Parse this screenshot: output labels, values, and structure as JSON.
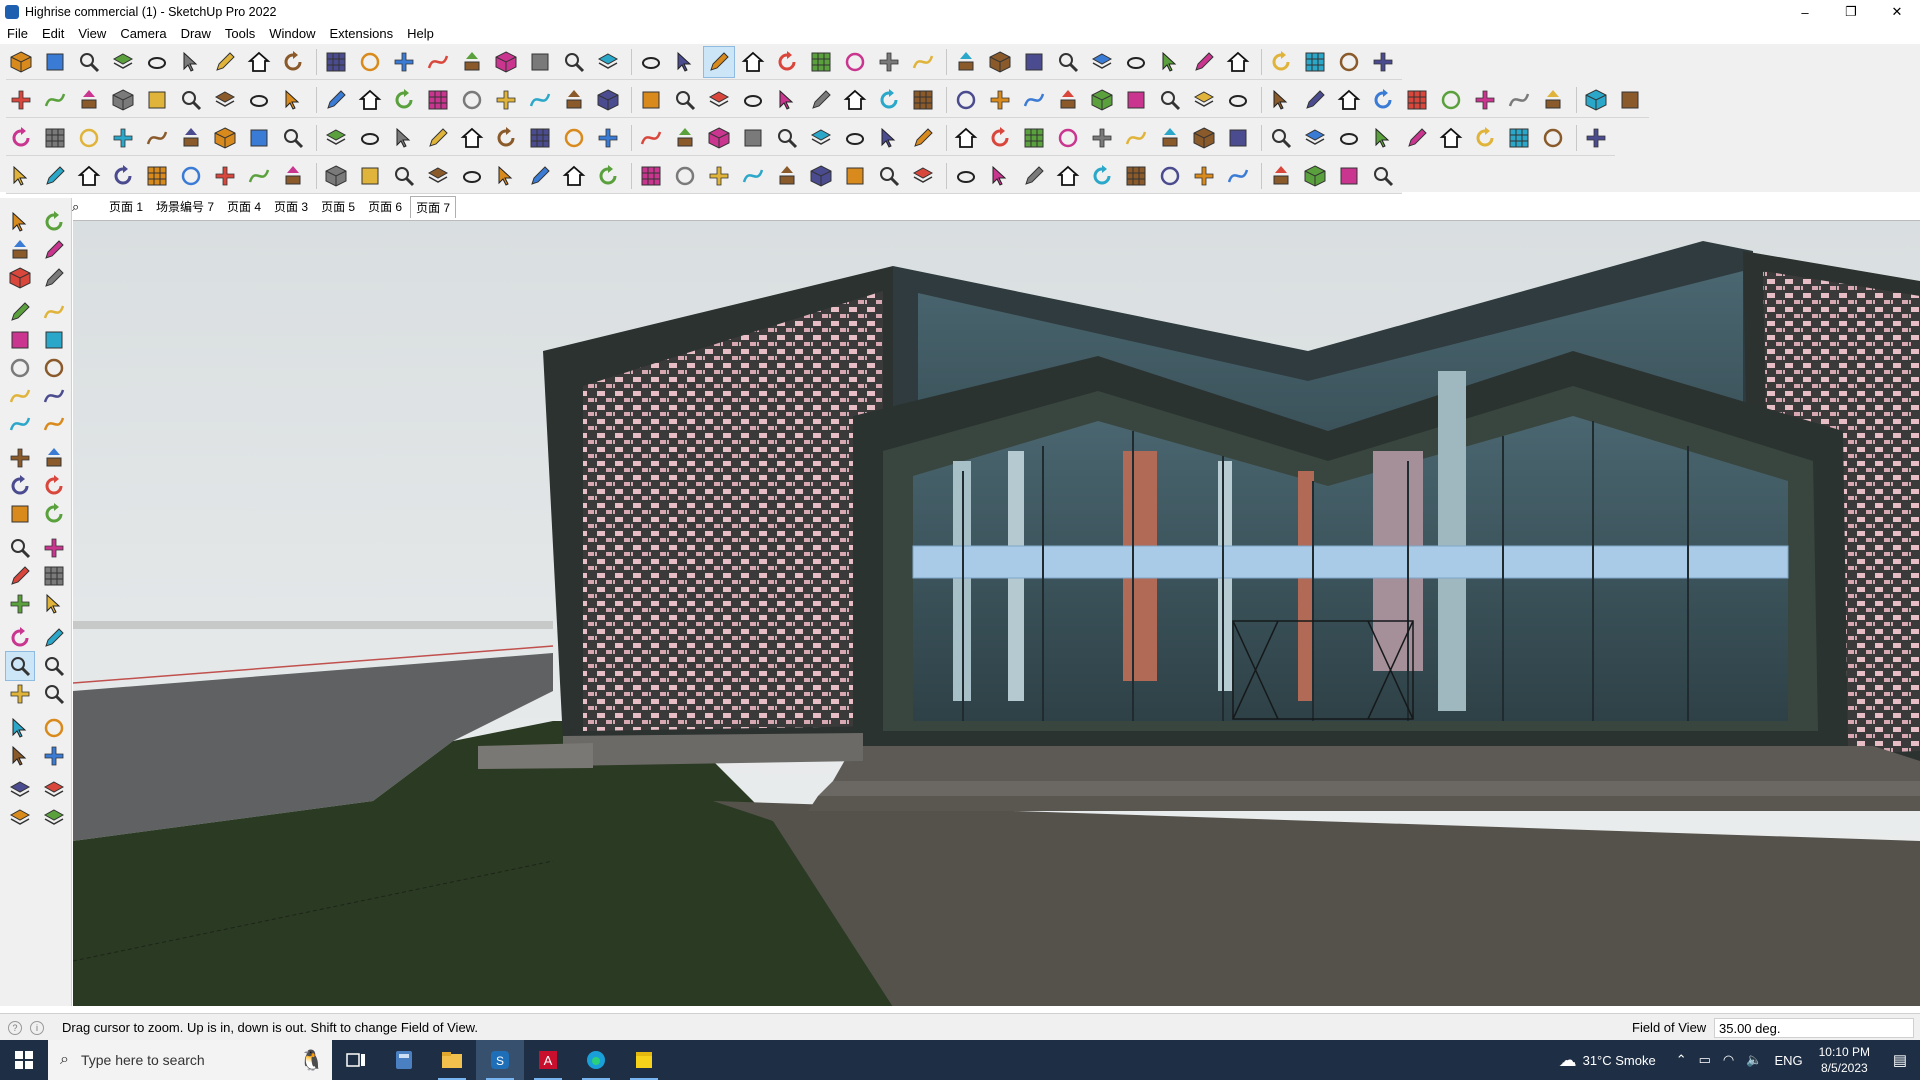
{
  "window": {
    "title": "Highrise commercial (1) - SketchUp Pro 2022",
    "minimize": "–",
    "maximize": "❐",
    "close": "✕"
  },
  "menubar": [
    "File",
    "Edit",
    "View",
    "Camera",
    "Draw",
    "Tools",
    "Window",
    "Extensions",
    "Help"
  ],
  "scenes": {
    "tabs": [
      "页面 1",
      "场景编号 7",
      "页面 4",
      "页面 3",
      "页面 5",
      "页面 6",
      "页面 7"
    ],
    "active_index": 6
  },
  "status": {
    "hint": "Drag cursor to zoom.  Up is in, down is out. Shift to change Field of View.",
    "vcb_label": "Field of View",
    "vcb_value": "35.00 deg."
  },
  "taskbar": {
    "search_placeholder": "Type here to search",
    "apps": [
      {
        "icon": "task-view-icon",
        "open": false
      },
      {
        "icon": "calculator-icon",
        "open": false
      },
      {
        "icon": "file-explorer-icon",
        "open": true
      },
      {
        "icon": "sketchup-icon",
        "open": true,
        "active": true
      },
      {
        "icon": "autocad-icon",
        "open": true
      },
      {
        "icon": "edge-icon",
        "open": true
      },
      {
        "icon": "sticky-notes-icon",
        "open": true
      }
    ],
    "weather": "31°C  Smoke",
    "language": "ENG",
    "time": "10:10 PM",
    "date": "8/5/2023"
  },
  "colors": {
    "sky_top": "#dde1e3",
    "sky_bottom": "#cfd5d7",
    "ground": "#2d3a24",
    "paving": "#5a564f",
    "frame": "#2f3532",
    "brick_base": "#3b3b3b",
    "brick_tile": "#e3b9c2",
    "glass": "#3c5258",
    "band": "#a9cbe8",
    "accent_column": "#b06a55"
  }
}
